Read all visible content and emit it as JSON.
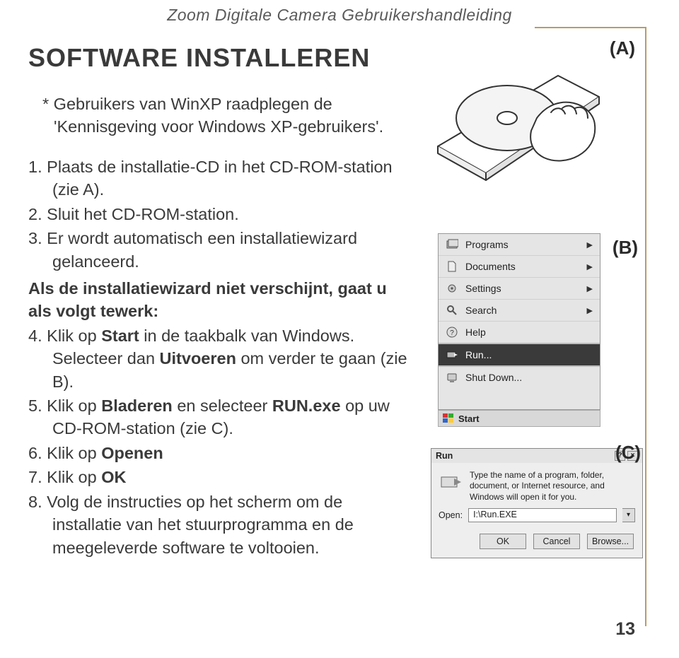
{
  "header": {
    "title": "Zoom Digitale Camera Gebruikershandleiding"
  },
  "left": {
    "heading_lead": "S",
    "heading_rest": "OFTWARE INSTALLEREN",
    "note": "* Gebruikers van WinXP raadplegen de 'Kennisgeving voor Windows XP-gebruikers'.",
    "steps": {
      "s1": {
        "num": "1.",
        "text": "Plaats de installatie-CD in het CD-ROM-station (zie A)."
      },
      "s2": {
        "num": "2.",
        "text": "Sluit het CD-ROM-station."
      },
      "s3": {
        "num": "3.",
        "text": "Er wordt automatisch een installatiewizard gelanceerd."
      }
    },
    "subhead": "Als de installatiewizard niet verschijnt, gaat u als volgt tewerk:",
    "steps2": {
      "s4": {
        "num": "4.",
        "pre": "Klik op ",
        "b1": "Start",
        "mid": " in de taakbalk van Windows. Selecteer dan ",
        "b2": "Uitvoeren",
        "post": " om verder te gaan (zie B)."
      },
      "s5": {
        "num": "5.",
        "pre": "Klik op ",
        "b1": "Bladeren",
        "mid": " en selecteer ",
        "b2": "RUN.exe",
        "post": " op uw CD-ROM-station (zie C)."
      },
      "s6": {
        "num": "6.",
        "pre": "Klik op ",
        "b1": "Openen"
      },
      "s7": {
        "num": "7.",
        "pre": "Klik op ",
        "b1": "OK"
      },
      "s8": {
        "num": "8.",
        "text": "Volg de instructies op het scherm om de installatie van het stuurprogramma en de meegeleverde software te voltooien."
      }
    }
  },
  "labels": {
    "a": "(A)",
    "b": "(B)",
    "c": "(C)"
  },
  "start_menu": {
    "items": [
      {
        "icon": "programs-icon",
        "label": "Programs",
        "arrow": true
      },
      {
        "icon": "documents-icon",
        "label": "Documents",
        "arrow": true
      },
      {
        "icon": "settings-icon",
        "label": "Settings",
        "arrow": true
      },
      {
        "icon": "search-icon",
        "label": "Search",
        "arrow": true
      },
      {
        "icon": "help-icon",
        "label": "Help",
        "arrow": false
      },
      {
        "icon": "run-icon",
        "label": "Run...",
        "arrow": false
      },
      {
        "icon": "shutdown-icon",
        "label": "Shut Down...",
        "arrow": false
      }
    ],
    "start_label": "Start"
  },
  "run_dialog": {
    "title": "Run",
    "help_btn": "?",
    "close_btn": "×",
    "prompt": "Type the name of a program, folder, document, or Internet resource, and Windows will open it for you.",
    "open_label": "Open:",
    "open_value": "I:\\Run.EXE",
    "buttons": {
      "ok": "OK",
      "cancel": "Cancel",
      "browse": "Browse..."
    }
  },
  "page_number": "13"
}
